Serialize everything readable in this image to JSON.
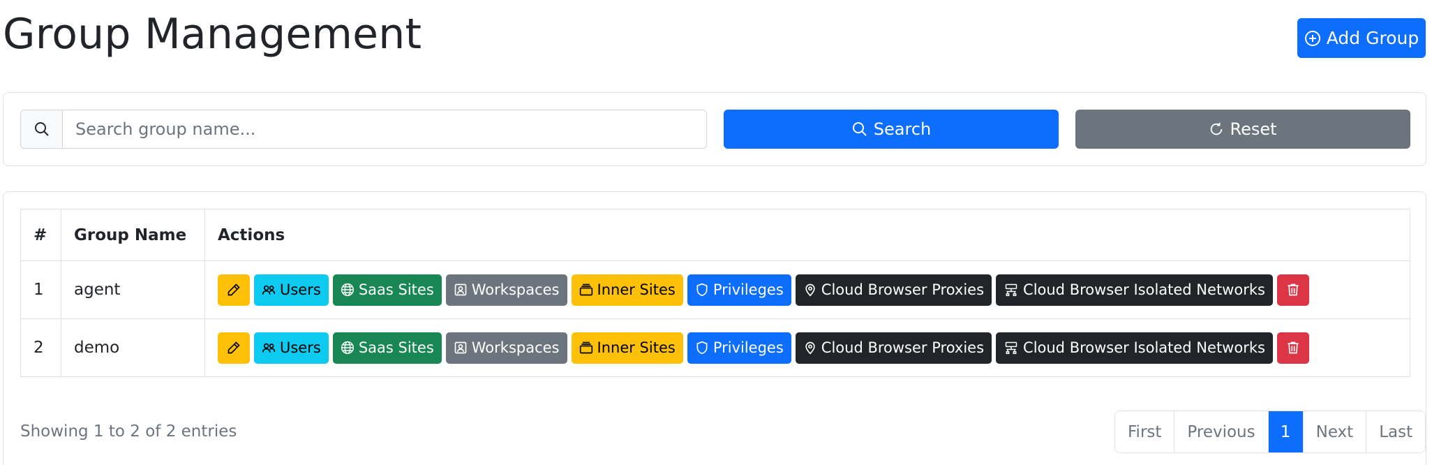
{
  "header": {
    "title": "Group Management",
    "add_button_label": "Add Group"
  },
  "search": {
    "placeholder": "Search group name...",
    "value": "",
    "search_label": "Search",
    "reset_label": "Reset"
  },
  "table": {
    "columns": [
      "#",
      "Group Name",
      "Actions"
    ],
    "action_labels": {
      "users": "Users",
      "saas_sites": "Saas Sites",
      "workspaces": "Workspaces",
      "inner_sites": "Inner Sites",
      "privileges": "Privileges",
      "proxies": "Cloud Browser Proxies",
      "isolated_networks": "Cloud Browser Isolated Networks"
    },
    "rows": [
      {
        "index": "1",
        "name": "agent"
      },
      {
        "index": "2",
        "name": "demo"
      }
    ]
  },
  "footer": {
    "showing_text": "Showing 1 to 2 of 2 entries"
  },
  "pagination": {
    "first": "First",
    "previous": "Previous",
    "current": "1",
    "next": "Next",
    "last": "Last"
  },
  "icons": {
    "add": "plus-circle-icon",
    "search": "search-icon",
    "reset": "refresh-icon",
    "edit": "pencil-icon",
    "users": "people-icon",
    "saas": "globe-icon",
    "workspaces": "person-badge-icon",
    "inner": "stack-icon",
    "privileges": "shield-icon",
    "proxies": "location-pin-icon",
    "isolated": "network-icon",
    "delete": "trash-icon"
  },
  "colors": {
    "primary": "#0d6efd",
    "secondary": "#6c757d",
    "warning": "#ffc107",
    "info": "#0dcaf0",
    "success": "#198754",
    "dark": "#212529",
    "danger": "#dc3545"
  }
}
